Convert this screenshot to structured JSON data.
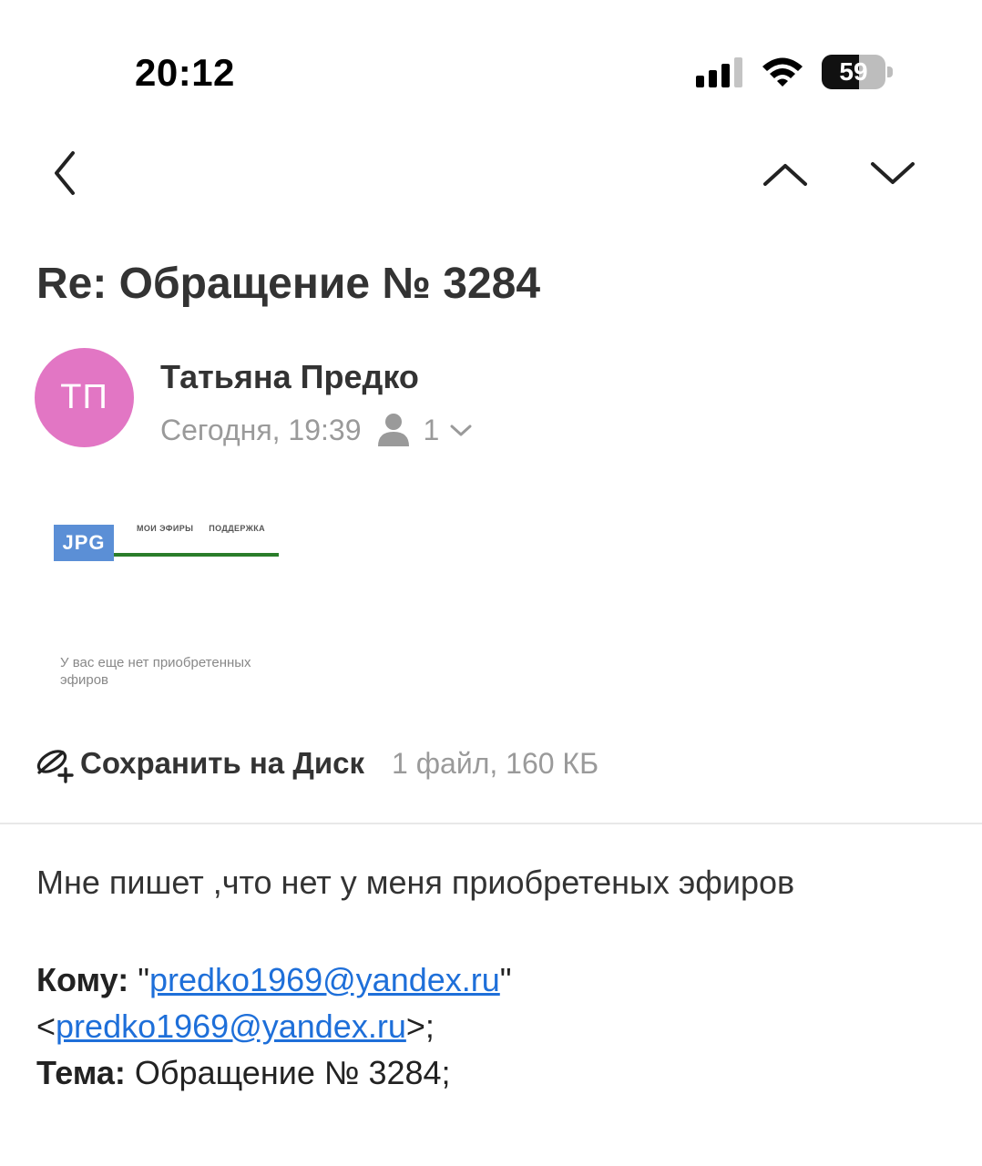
{
  "status_bar": {
    "time": "20:12",
    "battery_level": "59",
    "battery_fraction": 0.59,
    "icons": [
      "cellular-signal-icon",
      "wifi-icon",
      "battery-icon"
    ]
  },
  "nav": {
    "icons": [
      "back-chevron-icon",
      "chevron-up-icon",
      "chevron-down-icon"
    ]
  },
  "email": {
    "subject": "Re: Обращение № 3284",
    "sender": {
      "initials": "ТП",
      "name": "Татьяна Предко",
      "avatar_color": "#e276c4"
    },
    "date": "Сегодня, 19:39",
    "recipients_count": "1",
    "attachment": {
      "badge": "JPG",
      "thumbnail_menu": [
        "МОИ ЭФИРЫ",
        "ПОДДЕРЖКА"
      ],
      "thumbnail_text": "У вас еще нет приобретенных эфиров",
      "accent_color": "#2a7d2a",
      "badge_color": "#5b8fd6"
    },
    "save_to_disk_label": "Сохранить на Диск",
    "file_info": "1 файл, 160 КБ",
    "body": "Мне пишет ,что нет у меня приобретеных эфиров",
    "quoted": {
      "to_label": "Кому:",
      "to_quote_open": " \"",
      "to_email_1": "predko1969@yandex.ru",
      "to_quote_close": "\"",
      "to_angle_open": "<",
      "to_email_2": "predko1969@yandex.ru",
      "to_angle_close": ">;",
      "subject_label": "Тема:",
      "subject_value": " Обращение № 3284;"
    },
    "link_color": "#1e6fd9"
  }
}
